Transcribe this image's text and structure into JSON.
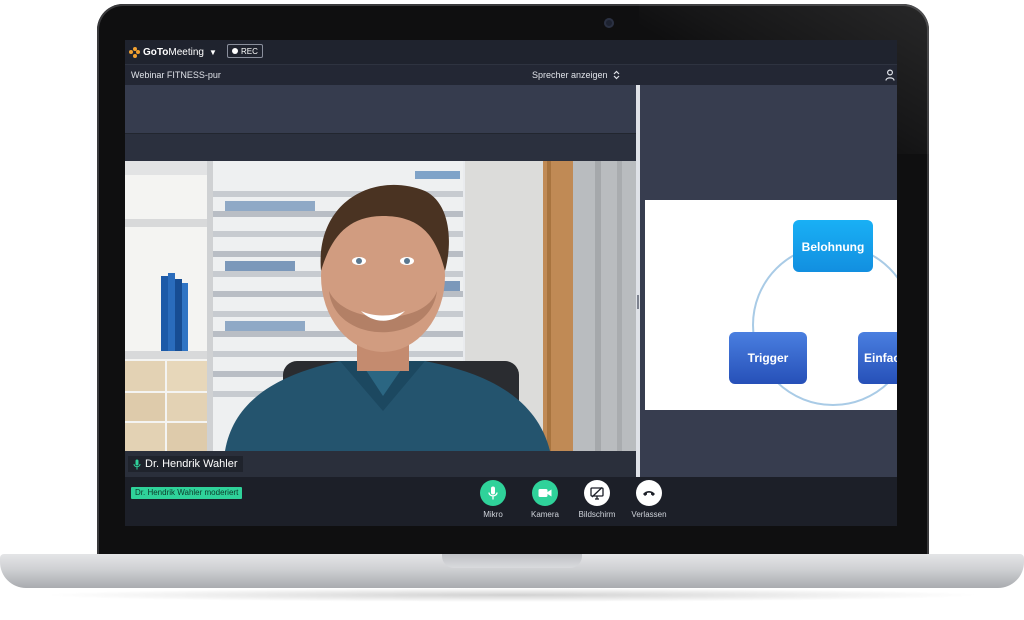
{
  "app": {
    "brand_prefix": "GoTo",
    "brand_suffix": "Meeting",
    "rec_label": "REC"
  },
  "titlebar": {
    "webinar_title": "Webinar FITNESS-pur",
    "view_mode": "Sprecher anzeigen"
  },
  "speaker": {
    "name": "Dr. Hendrik Wahler"
  },
  "slide": {
    "nodes": [
      "Belohnung",
      "Trigger",
      "Einfac"
    ]
  },
  "controls": {
    "moderator_badge": "Dr. Hendrik Wahler moderiert",
    "mic_label": "Mikro",
    "camera_label": "Kamera",
    "screen_label": "Bildschirm",
    "leave_label": "Verlassen"
  },
  "colors": {
    "mic_active": "#2fd29a",
    "camera_active": "#2fd29a",
    "slide_node_top": "#1aa0ee",
    "slide_node_bottom": "#2d5fc7",
    "moderator_badge": "#2fd29a"
  }
}
